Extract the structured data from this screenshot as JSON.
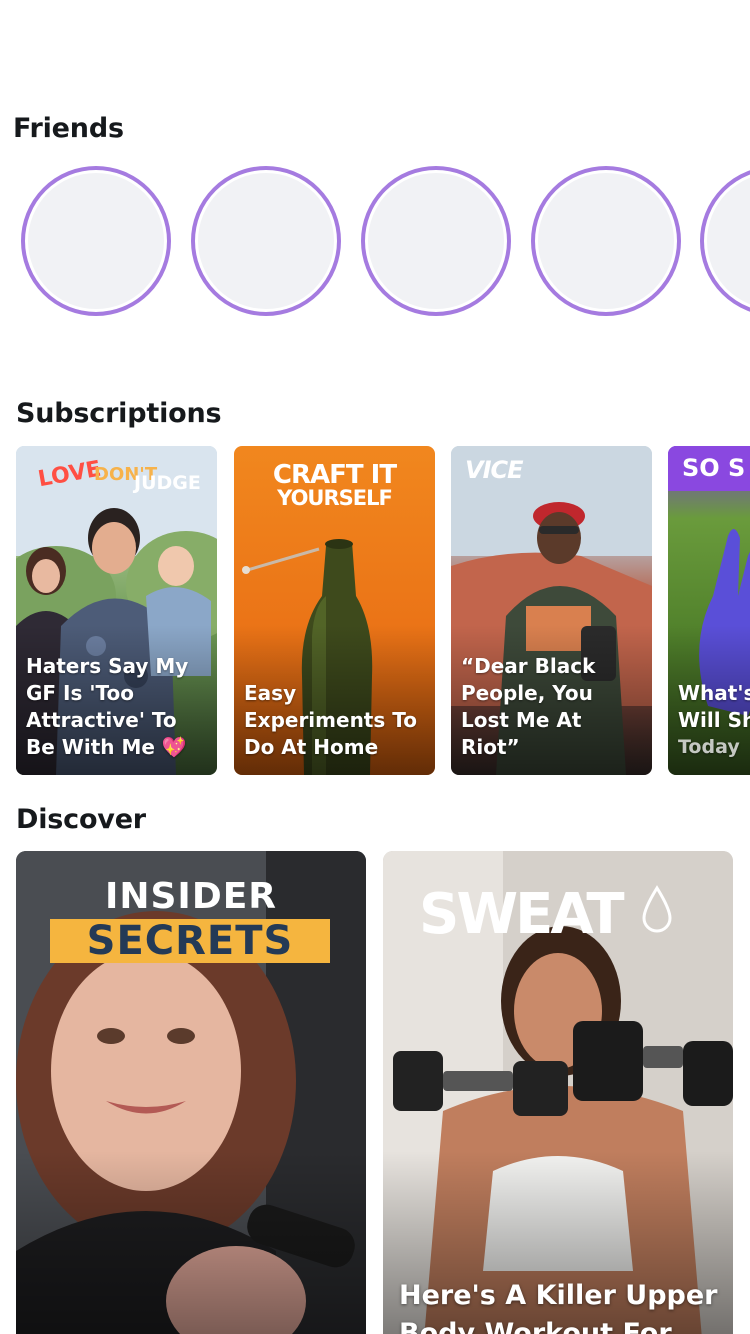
{
  "sections": {
    "friends": "Friends",
    "subscriptions": "Subscriptions",
    "discover": "Discover"
  },
  "friends": {
    "ring_color": "#a57be0",
    "placeholder_color": "#f1f2f5"
  },
  "subscriptions": [
    {
      "logo": "LOVE DON'T JUDGE",
      "logo_words": [
        "LOVE",
        "DON'T",
        "JUDGE"
      ],
      "caption": "Haters Say My GF Is 'Too Attractive' To Be With Me 💖"
    },
    {
      "logo": "CRAFT IT YOURSELF",
      "logo_lines": [
        "CRAFT IT",
        "YOURSELF"
      ],
      "caption": "Easy Experiments To Do At Home"
    },
    {
      "logo": "VICE",
      "caption": "“Dear Black People, You Lost Me At Riot”"
    },
    {
      "logo": "SO S",
      "caption": "What's Will Sh",
      "caption_lines": [
        "What's",
        "Will Sh"
      ],
      "meta": "Today"
    }
  ],
  "discover": [
    {
      "logo_lines": [
        "INSIDER",
        "SECRETS"
      ],
      "caption": ""
    },
    {
      "logo": "SWEAT",
      "caption": "Here's A Killer Upper Body Workout For"
    }
  ],
  "colors": {
    "title_text": "#16191c",
    "accent_purple": "#a57be0",
    "insider_yellow": "#f5b53f",
    "insider_navy": "#243a56"
  }
}
